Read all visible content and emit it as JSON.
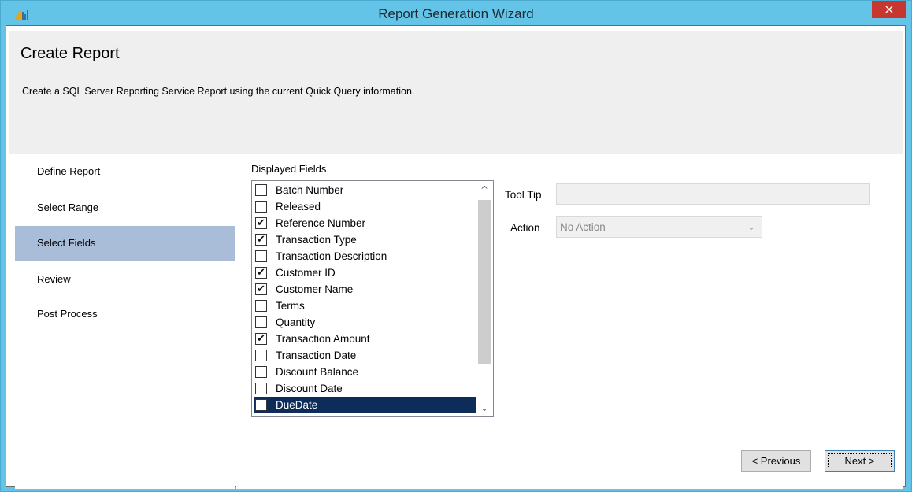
{
  "window": {
    "title": "Report Generation Wizard",
    "close_glyph": "×",
    "app_icon": "bar-chart-app-icon"
  },
  "header": {
    "title": "Create Report",
    "description": "Create a SQL Server Reporting Service Report using the current Quick Query information."
  },
  "nav": {
    "items": [
      {
        "label": "Define Report",
        "selected": false
      },
      {
        "label": "Select Range",
        "selected": false
      },
      {
        "label": "Select Fields",
        "selected": true
      },
      {
        "label": "Review",
        "selected": false
      },
      {
        "label": "Post Process",
        "selected": false
      }
    ]
  },
  "fields": {
    "label": "Displayed Fields",
    "items": [
      {
        "label": "Batch Number",
        "checked": false
      },
      {
        "label": "Released",
        "checked": false
      },
      {
        "label": "Reference Number",
        "checked": true
      },
      {
        "label": "Transaction Type",
        "checked": true
      },
      {
        "label": "Transaction Description",
        "checked": false
      },
      {
        "label": "Customer ID",
        "checked": true
      },
      {
        "label": "Customer Name",
        "checked": true
      },
      {
        "label": "Terms",
        "checked": false
      },
      {
        "label": "Quantity",
        "checked": false
      },
      {
        "label": "Transaction Amount",
        "checked": true
      },
      {
        "label": "Transaction Date",
        "checked": false
      },
      {
        "label": "Discount Balance",
        "checked": false
      },
      {
        "label": "Discount Date",
        "checked": false
      },
      {
        "label": "DueDate",
        "checked": false,
        "highlighted": true
      }
    ],
    "scroll_up_glyph": "^",
    "scroll_down_glyph": "⌄"
  },
  "tooltip": {
    "label": "Tool Tip",
    "value": ""
  },
  "action": {
    "label": "Action",
    "value": "No Action",
    "chevron_glyph": "⌄"
  },
  "buttons": {
    "previous": "< Previous",
    "next": "Next >"
  },
  "colors": {
    "titlebar": "#63c4e7",
    "close": "#c7372f",
    "nav_selected": "#aabdd8",
    "list_highlight": "#0e2c5a"
  }
}
